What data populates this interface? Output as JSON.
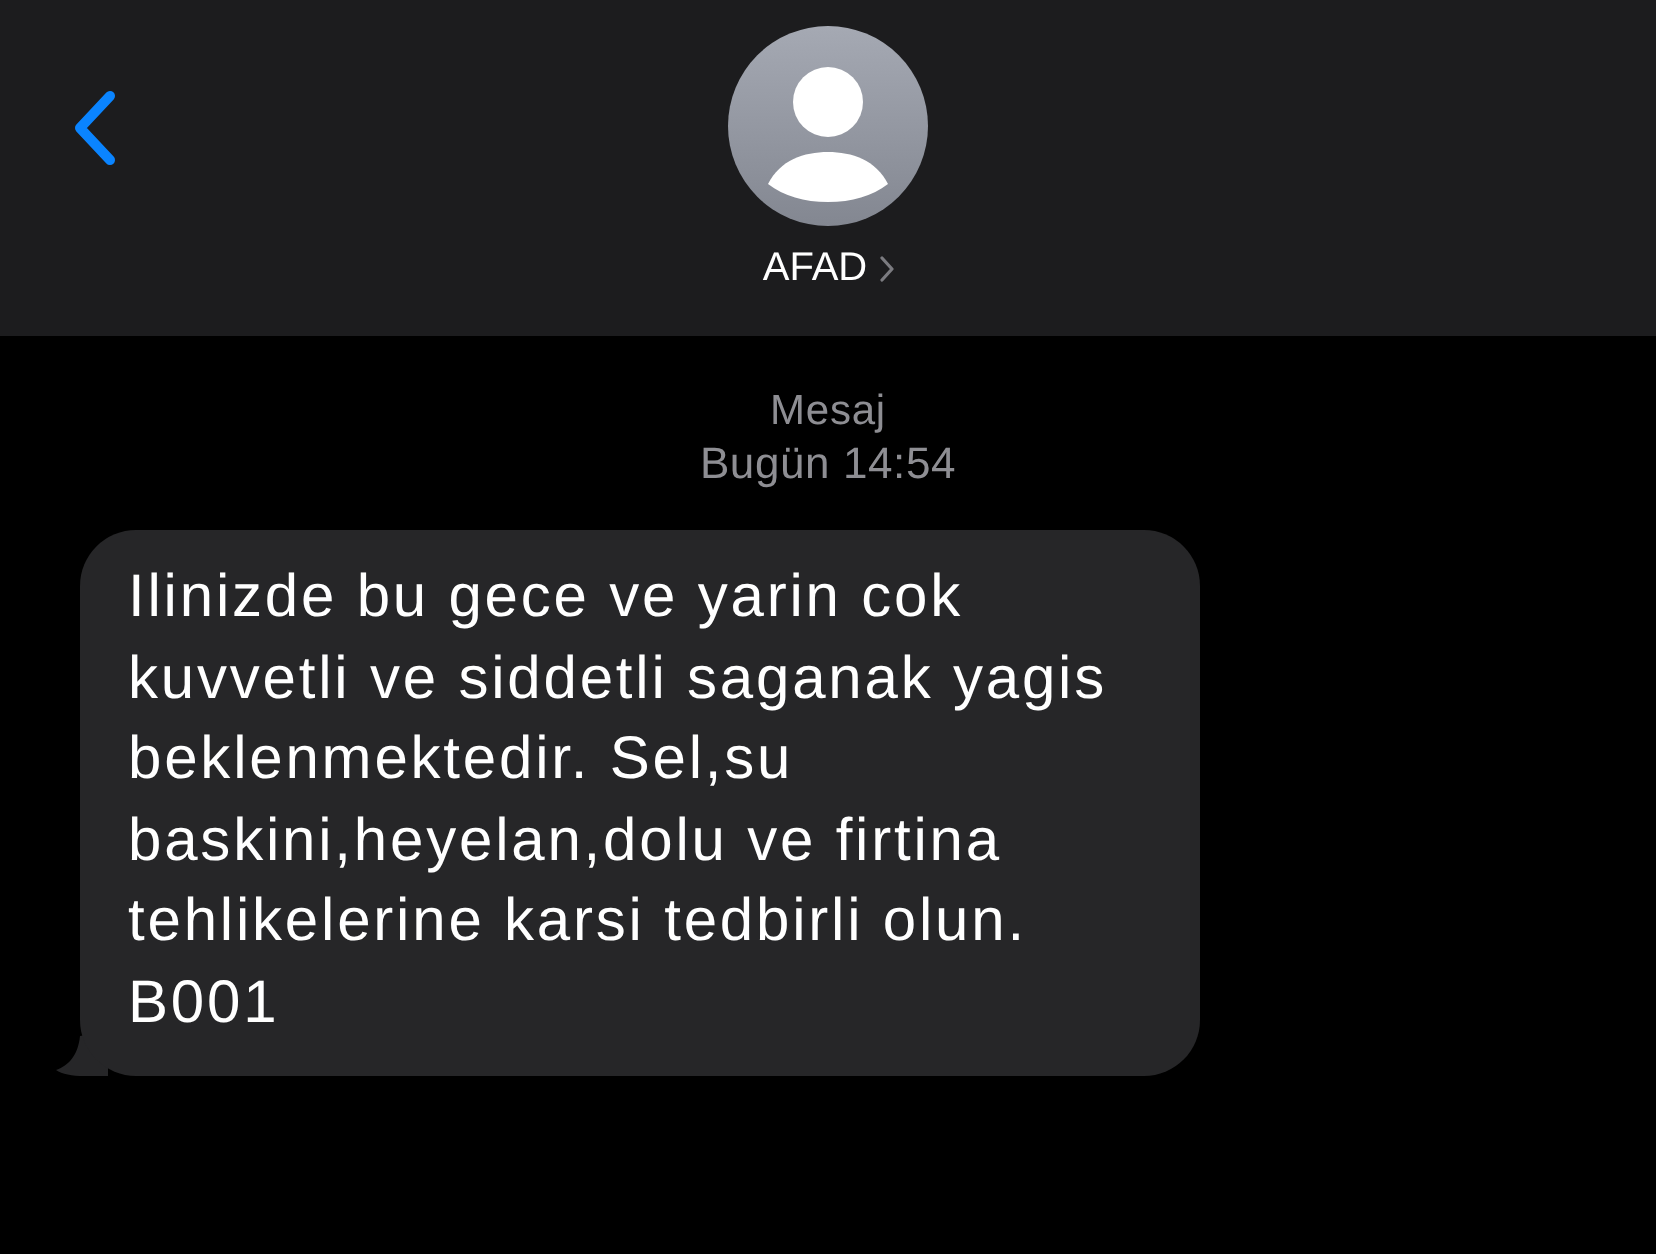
{
  "header": {
    "contact_name": "AFAD"
  },
  "message_meta": {
    "label": "Mesaj",
    "timestamp": "Bugün 14:54"
  },
  "messages": [
    {
      "kind": "received",
      "text": "Ilinizde bu gece ve yarin cok kuvvetli ve siddetli saganak yagis beklenmektedir. Sel,su baskini,heyelan,dolu ve firtina tehlikelerine karsi tedbirli olun. B001"
    }
  ]
}
